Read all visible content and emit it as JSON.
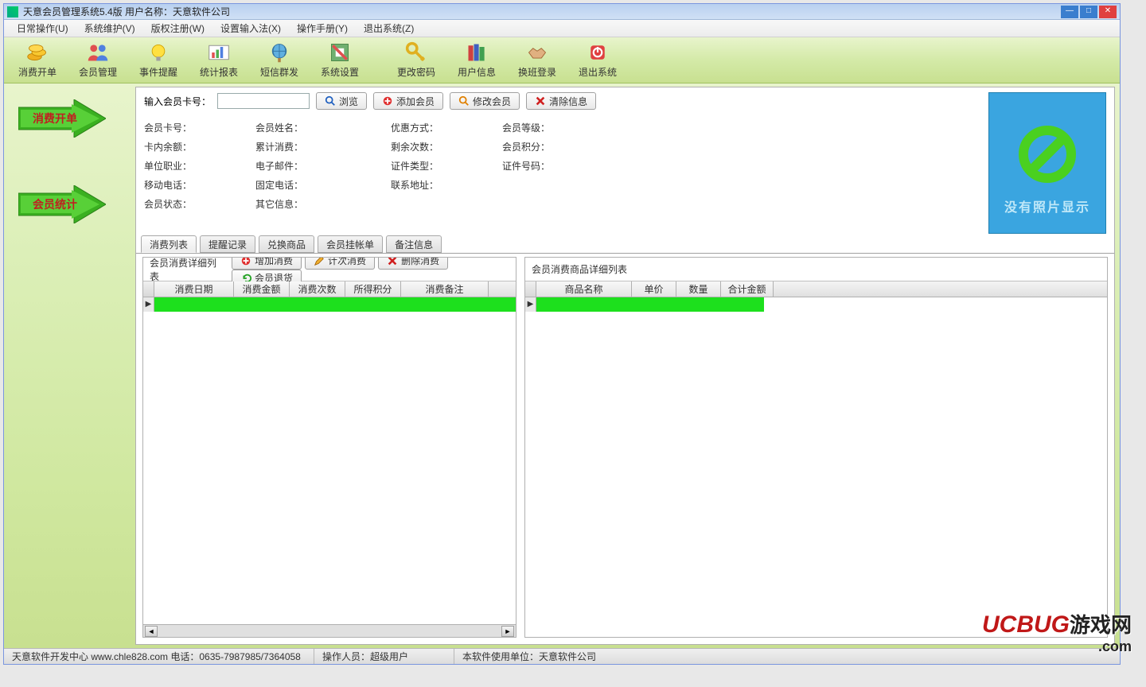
{
  "title": "天意会员管理系统5.4版      用户名称：天意软件公司",
  "menu": [
    "日常操作(U)",
    "系统维护(V)",
    "版权注册(W)",
    "设置输入法(X)",
    "操作手册(Y)",
    "退出系统(Z)"
  ],
  "toolbar": [
    {
      "label": "消费开单",
      "icon": "coins"
    },
    {
      "label": "会员管理",
      "icon": "people"
    },
    {
      "label": "事件提醒",
      "icon": "bulb"
    },
    {
      "label": "统计报表",
      "icon": "chart"
    },
    {
      "label": "短信群发",
      "icon": "globe"
    },
    {
      "label": "系统设置",
      "icon": "tools"
    },
    {
      "label": "更改密码",
      "icon": "key"
    },
    {
      "label": "用户信息",
      "icon": "books"
    },
    {
      "label": "换班登录",
      "icon": "handshake"
    },
    {
      "label": "退出系统",
      "icon": "power"
    }
  ],
  "sidebar": {
    "btn1": "消费开单",
    "btn2": "会员统计"
  },
  "search": {
    "label": "输入会员卡号：",
    "browse": "浏览",
    "add": "添加会员",
    "edit": "修改会员",
    "clear": "清除信息"
  },
  "info": {
    "r1": [
      "会员卡号：",
      "会员姓名：",
      "优惠方式：",
      "会员等级："
    ],
    "r2": [
      "卡内余额：",
      "累计消费：",
      "剩余次数：",
      "会员积分："
    ],
    "r3": [
      "单位职业：",
      "电子邮件：",
      "证件类型：",
      "证件号码："
    ],
    "r4": [
      "移动电话：",
      "固定电话：",
      "联系地址：",
      ""
    ],
    "r5": [
      "会员状态：",
      "其它信息：",
      "",
      ""
    ]
  },
  "photo_text": "没有照片显示",
  "tabs": [
    "消费列表",
    "提醒记录",
    "兑换商品",
    "会员挂帐单",
    "备注信息"
  ],
  "left_panel": {
    "title": "会员消费详细列表",
    "btns": [
      {
        "label": "增加消费",
        "icon": "plus"
      },
      {
        "label": "计次消费",
        "icon": "pencil"
      },
      {
        "label": "删除消费",
        "icon": "x"
      },
      {
        "label": "会员退货",
        "icon": "undo"
      }
    ],
    "cols": [
      "消费日期",
      "消费金额",
      "消费次数",
      "所得积分",
      "消费备注"
    ]
  },
  "right_panel": {
    "title": "会员消费商品详细列表",
    "cols": [
      "商品名称",
      "单价",
      "数量",
      "合计金额"
    ]
  },
  "status": {
    "s1": "天意软件开发中心 www.chle828.com 电话：0635-7987985/7364058",
    "s2": "操作人员：超级用户",
    "s3": "本软件使用单位：天意软件公司"
  },
  "watermark": {
    "a": "UCBUG",
    "b": "游戏网",
    "c": ".com"
  }
}
